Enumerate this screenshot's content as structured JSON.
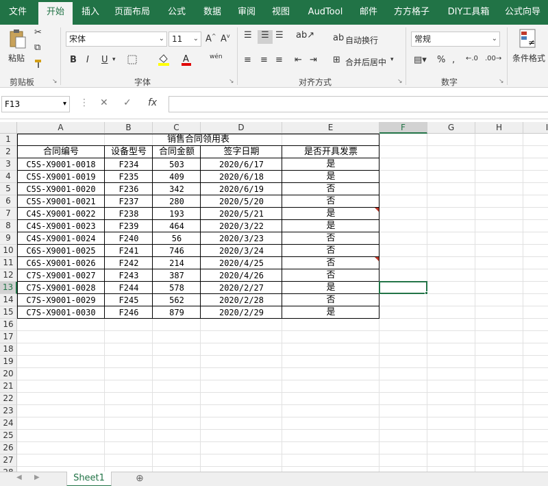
{
  "ribbon": {
    "tabs": [
      "文件",
      "开始",
      "插入",
      "页面布局",
      "公式",
      "数据",
      "审阅",
      "视图",
      "AudTool",
      "邮件",
      "方方格子",
      "DIY工具箱",
      "公式向导"
    ],
    "active_tab": "开始",
    "clipboard": {
      "paste": "粘贴",
      "group": "剪贴板"
    },
    "font": {
      "name": "宋体",
      "size": "11",
      "bold": "B",
      "italic": "I",
      "underline": "U",
      "group": "字体",
      "phonetic": "wén"
    },
    "alignment": {
      "wrap": "自动换行",
      "merge": "合并后居中",
      "group": "对齐方式"
    },
    "number": {
      "format": "常规",
      "percent": "%",
      "group": "数字"
    },
    "styles": {
      "conditional": "条件格式"
    }
  },
  "formula_bar": {
    "name_box": "F13",
    "fx": "fx",
    "value": ""
  },
  "grid": {
    "columns": [
      "A",
      "B",
      "C",
      "D",
      "E",
      "F",
      "G",
      "H",
      "I"
    ],
    "selected_column": "F",
    "selected_row": "13",
    "rows": [
      "1",
      "2",
      "3",
      "4",
      "5",
      "6",
      "7",
      "8",
      "9",
      "10",
      "11",
      "12",
      "13",
      "14",
      "15",
      "16",
      "17",
      "18",
      "19",
      "20",
      "21",
      "22",
      "23",
      "24",
      "25",
      "26",
      "27",
      "28"
    ]
  },
  "table": {
    "title": "销售合同领用表",
    "headers": [
      "合同编号",
      "设备型号",
      "合同金额",
      "签字日期",
      "是否开具发票"
    ],
    "rows": [
      [
        "C5S-X9001-0018",
        "F234",
        "503",
        "2020/6/17",
        "是"
      ],
      [
        "C5S-X9001-0019",
        "F235",
        "409",
        "2020/6/18",
        "是"
      ],
      [
        "C5S-X9001-0020",
        "F236",
        "342",
        "2020/6/19",
        "否"
      ],
      [
        "C5S-X9001-0021",
        "F237",
        "280",
        "2020/5/20",
        "否"
      ],
      [
        "C4S-X9001-0022",
        "F238",
        "193",
        "2020/5/21",
        "是"
      ],
      [
        "C4S-X9001-0023",
        "F239",
        "464",
        "2020/3/22",
        "是"
      ],
      [
        "C4S-X9001-0024",
        "F240",
        "56",
        "2020/3/23",
        "否"
      ],
      [
        "C6S-X9001-0025",
        "F241",
        "746",
        "2020/3/24",
        "否"
      ],
      [
        "C6S-X9001-0026",
        "F242",
        "214",
        "2020/4/25",
        "否"
      ],
      [
        "C7S-X9001-0027",
        "F243",
        "387",
        "2020/4/26",
        "否"
      ],
      [
        "C7S-X9001-0028",
        "F244",
        "578",
        "2020/2/27",
        "是"
      ],
      [
        "C7S-X9001-0029",
        "F245",
        "562",
        "2020/2/28",
        "否"
      ],
      [
        "C7S-X9001-0030",
        "F246",
        "879",
        "2020/2/29",
        "是"
      ]
    ]
  },
  "sheets": {
    "active": "Sheet1"
  },
  "colors": {
    "accent": "#217346",
    "comment": "#c0392b"
  }
}
